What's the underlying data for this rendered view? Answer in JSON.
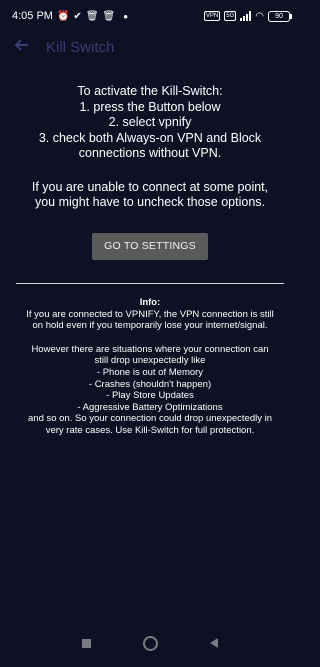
{
  "status_bar": {
    "time": "4:05 PM",
    "icons_left": [
      "alarm-icon",
      "check-icon",
      "trash-icon",
      "trash-icon"
    ],
    "vpn_badge": "VPN",
    "battery": "90"
  },
  "app_bar": {
    "title": "Kill Switch",
    "back_icon": "arrow-left-icon"
  },
  "instructions": {
    "line1": "To activate the Kill-Switch:",
    "line2": "1. press the Button below",
    "line3": "2. select vpnify",
    "line4": "3. check both Always-on VPN and Block",
    "line5": "connections without VPN."
  },
  "unable": {
    "line1": "If you are unable to connect at some point,",
    "line2": "you might have to uncheck those options."
  },
  "settings_button_label": "GO TO SETTINGS",
  "info": {
    "heading": "Info:",
    "p1_line1": "If you are connected to VPNIFY, the VPN connection is still",
    "p1_line2": "on hold even if you temporarily lose your internet/signal.",
    "p2_line1": "However there are situations where your connection can",
    "p2_line2": "still drop unexpectedly like",
    "p2_line3": "- Phone is out of Memory",
    "p2_line4": "- Crashes (shouldn't happen)",
    "p2_line5": "- Play Store Updates",
    "p2_line6": "- Aggressive Battery Optimizations",
    "p2_line7": "and so on. So your connection could drop unexpectedly in",
    "p2_line8": "very rate cases. Use Kill-Switch for full protection."
  },
  "colors": {
    "background": "#0e1024",
    "title": "#3a3e72",
    "button": "#5a5a5a"
  }
}
